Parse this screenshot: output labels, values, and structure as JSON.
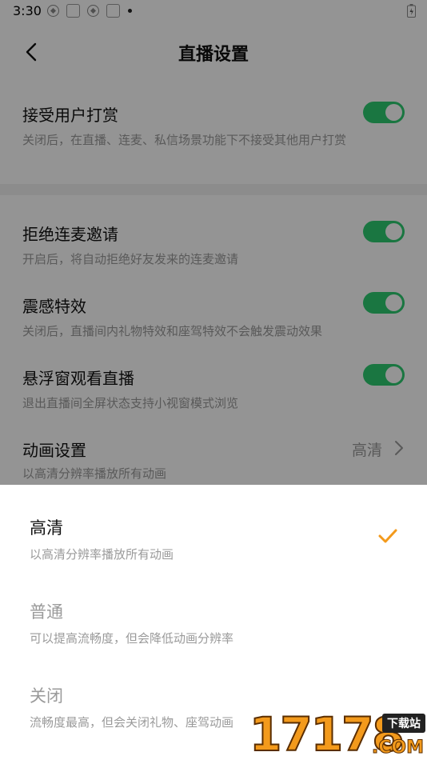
{
  "status_bar": {
    "time": "3:30"
  },
  "header": {
    "title": "直播设置"
  },
  "settings": {
    "tip_rewards": {
      "title": "接受用户打赏",
      "desc": "关闭后，在直播、连麦、私信场景功能下不接受其他用户打赏",
      "enabled": true
    },
    "reject_link": {
      "title": "拒绝连麦邀请",
      "desc": "开启后，将自动拒绝好友发来的连麦邀请",
      "enabled": true
    },
    "vibration": {
      "title": "震感特效",
      "desc": "关闭后，直播间内礼物特效和座驾特效不会触发震动效果",
      "enabled": true
    },
    "float_window": {
      "title": "悬浮窗观看直播",
      "desc": "退出直播间全屏状态支持小视窗模式浏览",
      "enabled": true
    },
    "animation": {
      "title": "动画设置",
      "desc": "以高清分辨率播放所有动画",
      "value": "高清"
    }
  },
  "sheet": {
    "options": [
      {
        "title": "高清",
        "desc": "以高清分辨率播放所有动画",
        "selected": true
      },
      {
        "title": "普通",
        "desc": "可以提高流畅度，但会降低动画分辨率",
        "selected": false
      },
      {
        "title": "关闭",
        "desc": "流畅度最高，但会关闭礼物、座驾动画",
        "selected": false
      }
    ]
  },
  "watermark": {
    "number": "17178",
    "tag": "下载站",
    "suffix": ".COM"
  },
  "colors": {
    "toggle_on": "#2ecc71",
    "check": "#f39a1c",
    "overlay": "rgba(0,0,0,0.42)"
  }
}
